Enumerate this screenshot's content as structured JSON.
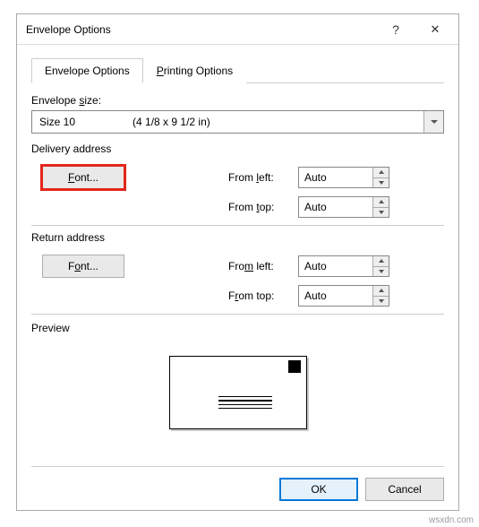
{
  "dialog": {
    "title": "Envelope Options",
    "help_tooltip": "?",
    "close_tooltip": "✕"
  },
  "tabs": {
    "envelope": "Envelope Options",
    "printing": "Printing Options"
  },
  "size": {
    "label_pre": "Envelope ",
    "label_u": "s",
    "label_post": "ize:",
    "value_name": "Size 10",
    "value_dim": "(4 1/8 x 9 1/2 in)"
  },
  "delivery": {
    "title": "Delivery address",
    "font_pre": "",
    "font_u": "F",
    "font_post": "ont...",
    "from_left_pre": "From ",
    "from_left_u": "l",
    "from_left_post": "eft:",
    "from_left_val": "Auto",
    "from_top_pre": "From ",
    "from_top_u": "t",
    "from_top_post": "op:",
    "from_top_val": "Auto"
  },
  "return": {
    "title": "Return address",
    "font_pre": "F",
    "font_u": "o",
    "font_post": "nt...",
    "from_left_pre": "Fro",
    "from_left_u": "m",
    "from_left_post": " left:",
    "from_left_val": "Auto",
    "from_top_pre": "F",
    "from_top_u": "r",
    "from_top_post": "om top:",
    "from_top_val": "Auto"
  },
  "preview": {
    "label": "Preview"
  },
  "buttons": {
    "ok": "OK",
    "cancel": "Cancel"
  },
  "watermark": "wsxdn.com"
}
